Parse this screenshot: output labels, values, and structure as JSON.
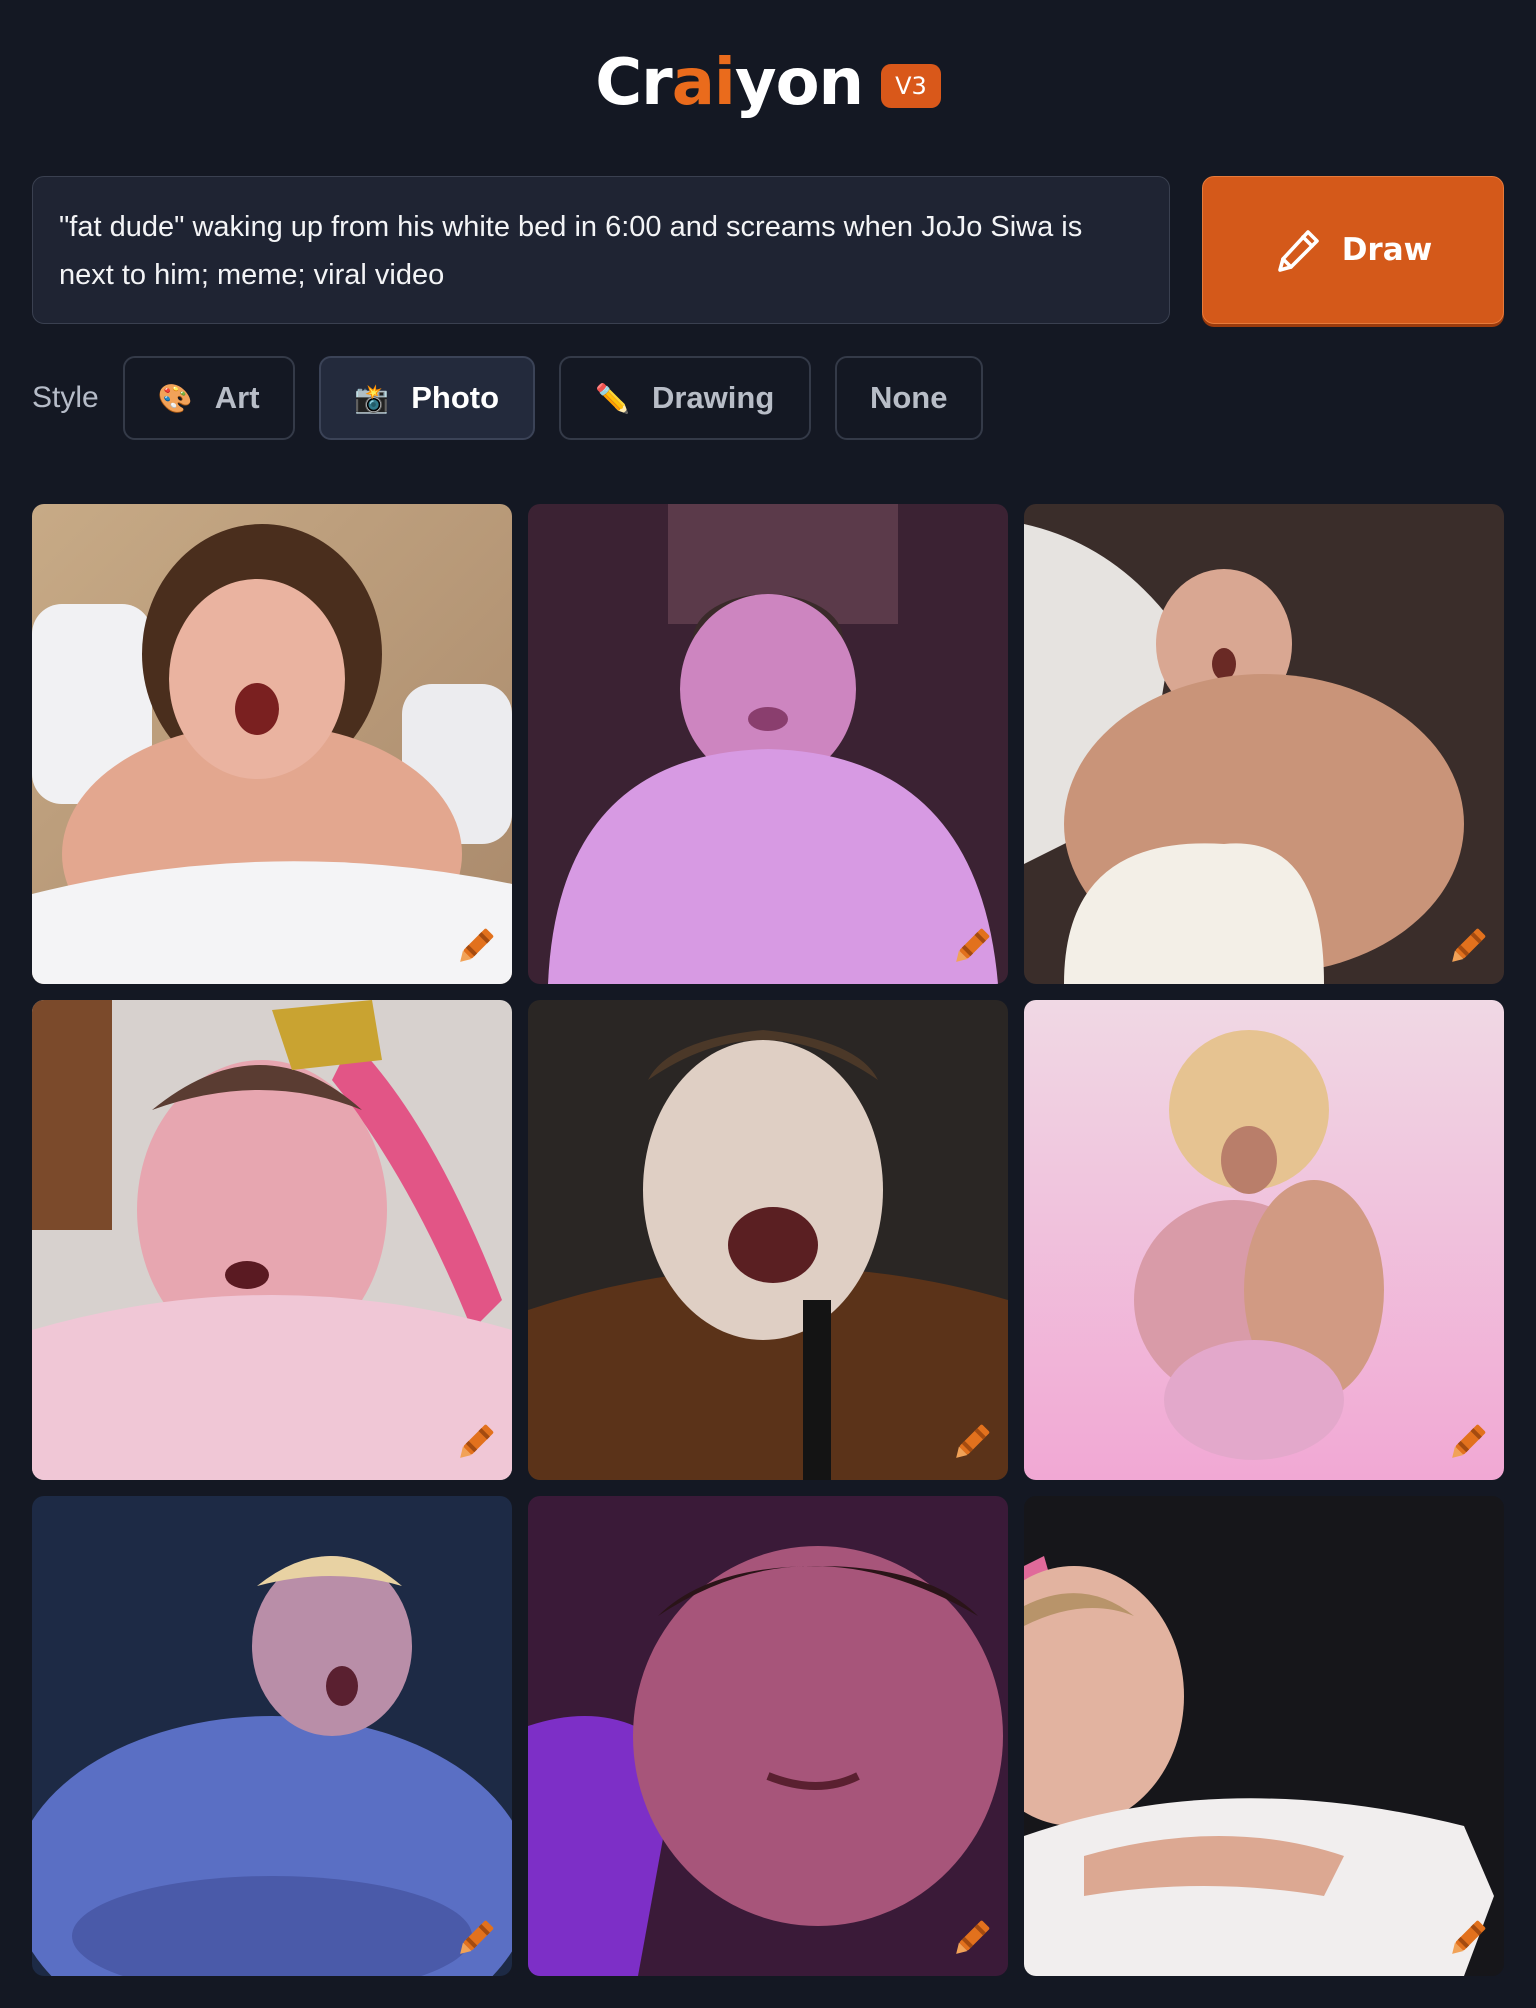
{
  "header": {
    "logo_prefix": "Cr",
    "logo_accent": "ai",
    "logo_suffix": "yon",
    "version": "V3"
  },
  "prompt": {
    "text": "\"fat dude\" waking up from his white bed in 6:00 and screams when JoJo Siwa is next to him; meme; viral video"
  },
  "draw_button": {
    "label": "Draw",
    "icon": "pencil-icon"
  },
  "style": {
    "label": "Style",
    "options": [
      {
        "label": "Art",
        "icon": "palette-icon",
        "emoji": "🎨",
        "selected": false
      },
      {
        "label": "Photo",
        "icon": "camera-icon",
        "emoji": "📸",
        "selected": true
      },
      {
        "label": "Drawing",
        "icon": "pencil-icon",
        "emoji": "✏️",
        "selected": false
      },
      {
        "label": "None",
        "icon": "",
        "emoji": "",
        "selected": false
      }
    ]
  },
  "results": {
    "count": 9,
    "edit_icon": "crayon-icon"
  },
  "colors": {
    "background": "#141823",
    "accent": "#d4591a",
    "panel": "#1f2433"
  }
}
